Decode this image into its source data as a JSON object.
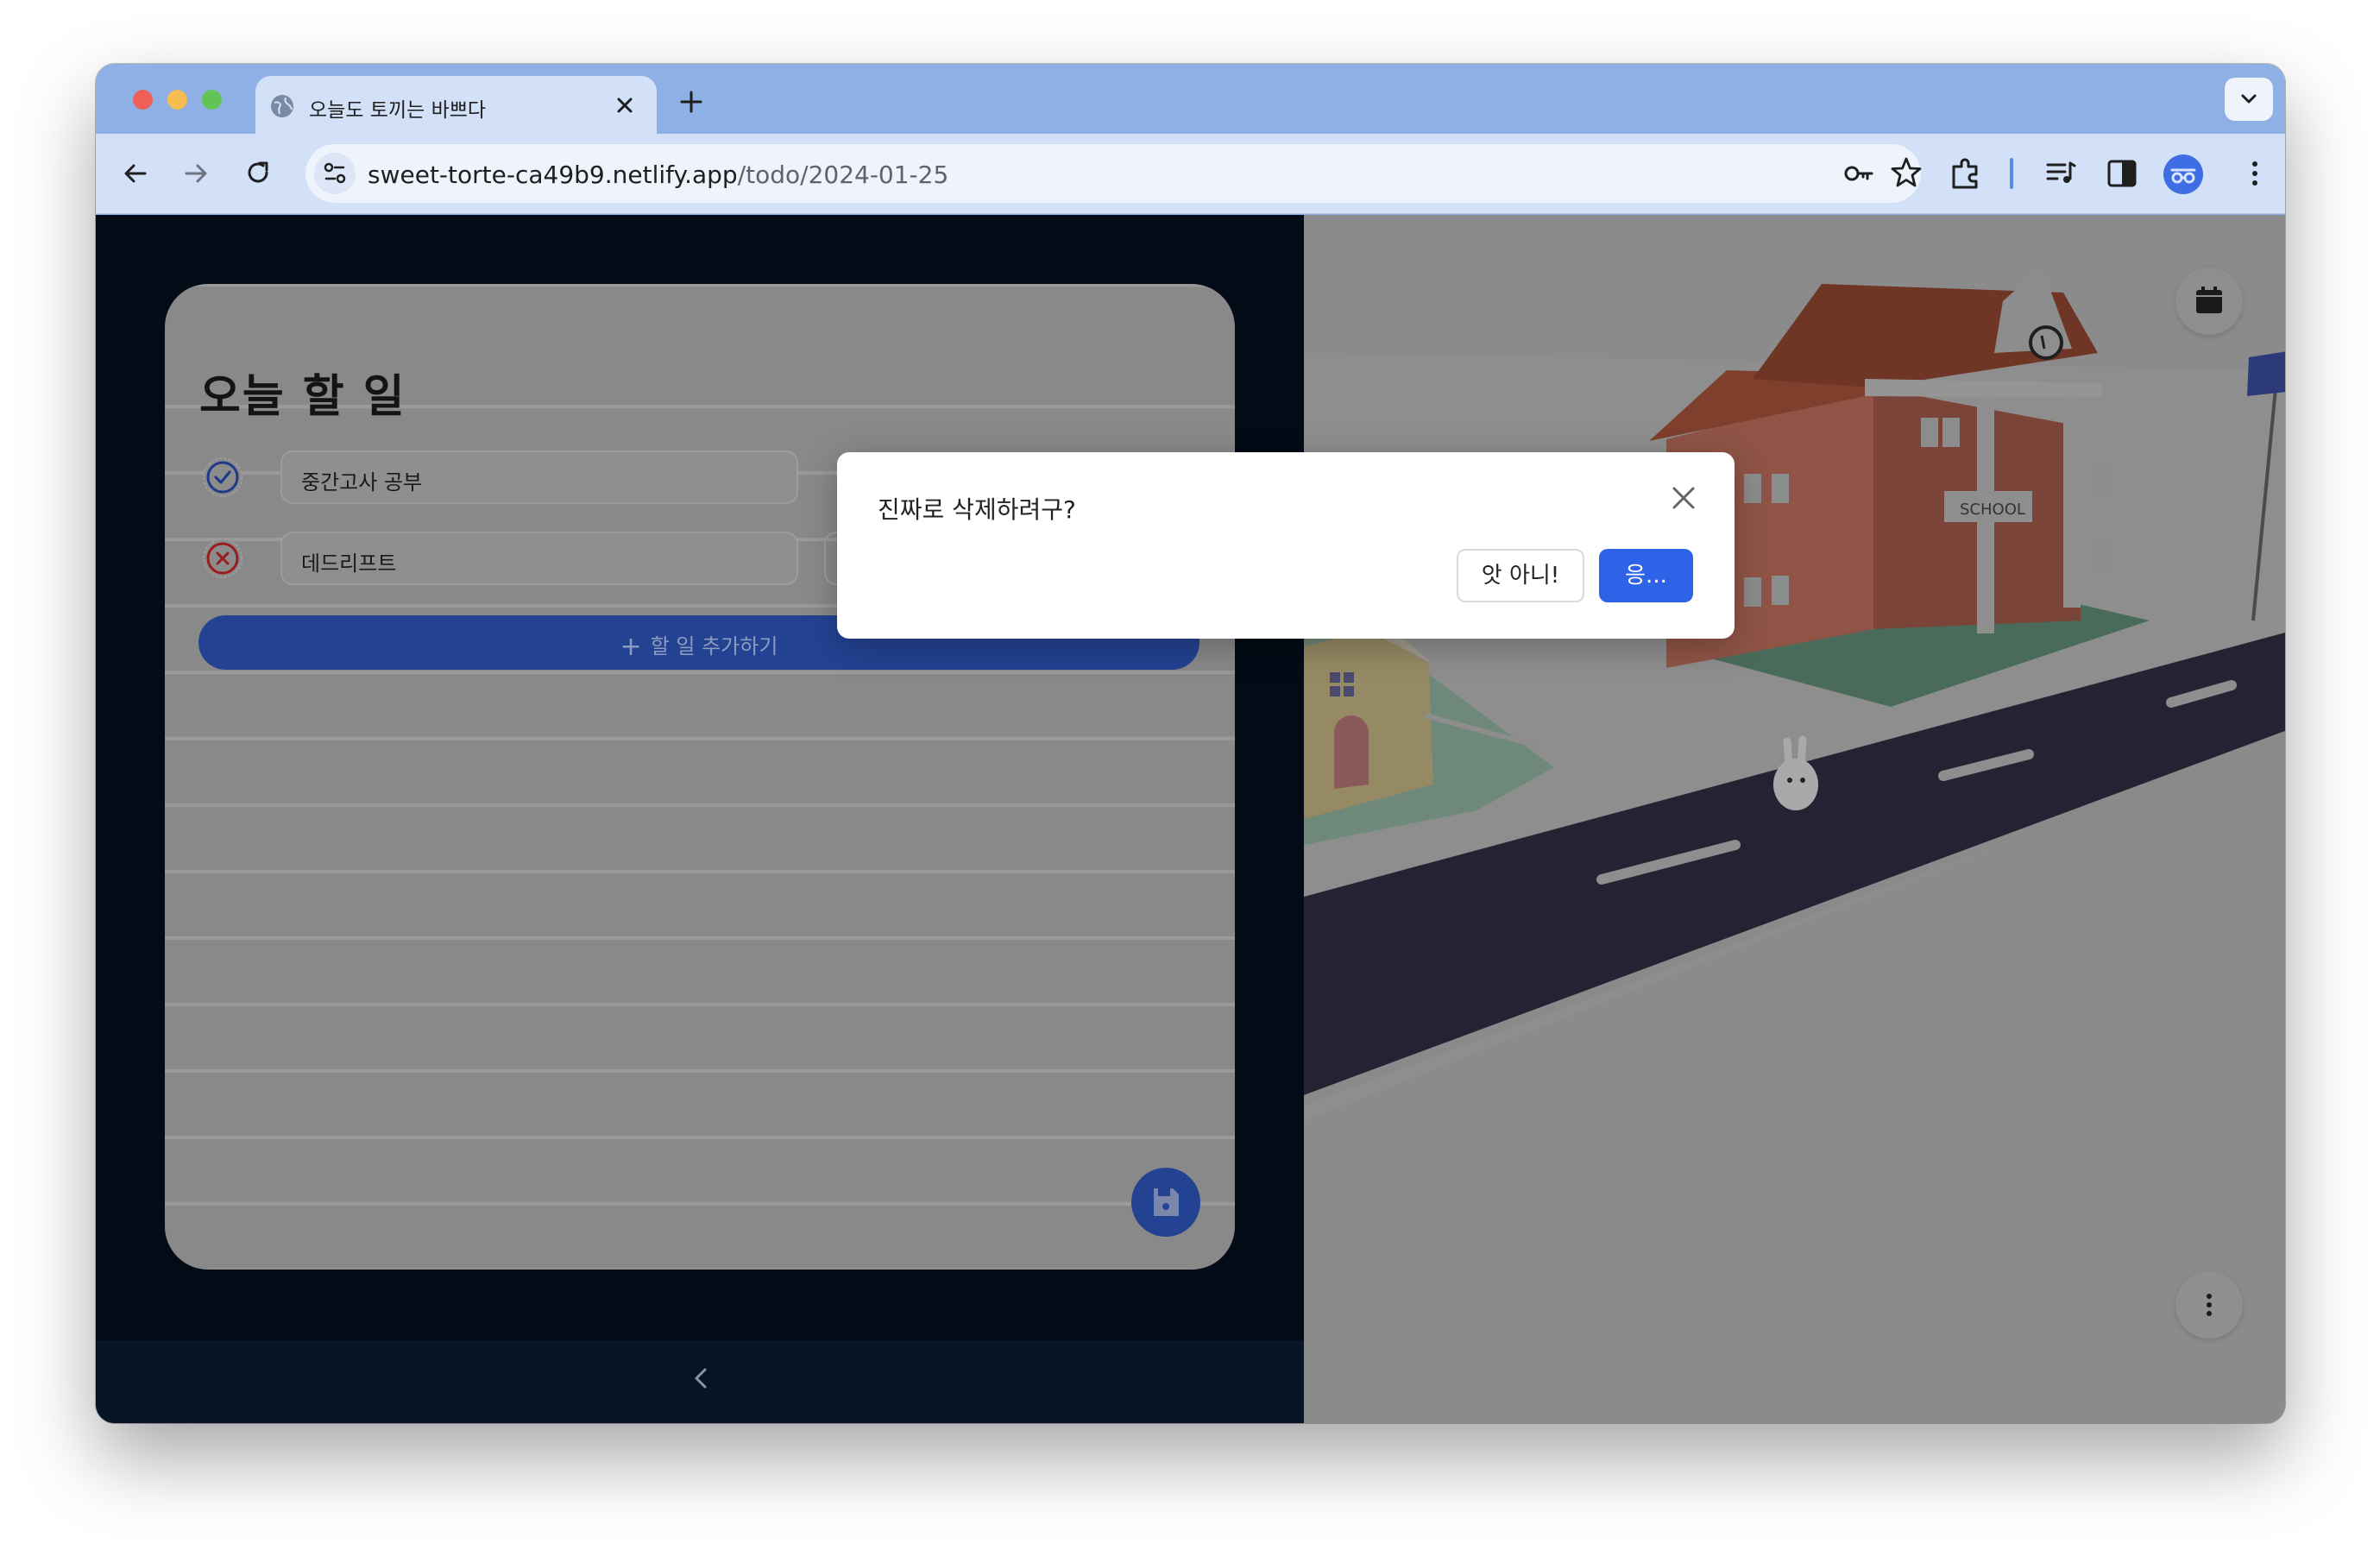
{
  "browser": {
    "tab_title": "오늘도 토끼는 바쁘다",
    "url_host": "sweet-torte-ca49b9.netlify.app",
    "url_path": "/todo/2024-01-25"
  },
  "todo_card": {
    "title": "오늘 할 일",
    "items": [
      {
        "text": "중간고사 공부",
        "status": "done",
        "icon": "check-circle-icon"
      },
      {
        "text": "데드리프트",
        "status": "failed",
        "icon": "x-circle-icon"
      }
    ],
    "add_label": "할 일 추가하기"
  },
  "scene": {
    "sign_text": "SCHOOL"
  },
  "dialog": {
    "message": "진짜로 삭제하려구?",
    "cancel_label": "앗 아니!",
    "confirm_label": "응..."
  },
  "colors": {
    "accent": "#2e63e8",
    "overlay_primary": "#234292",
    "left_bg": "#020b16"
  }
}
